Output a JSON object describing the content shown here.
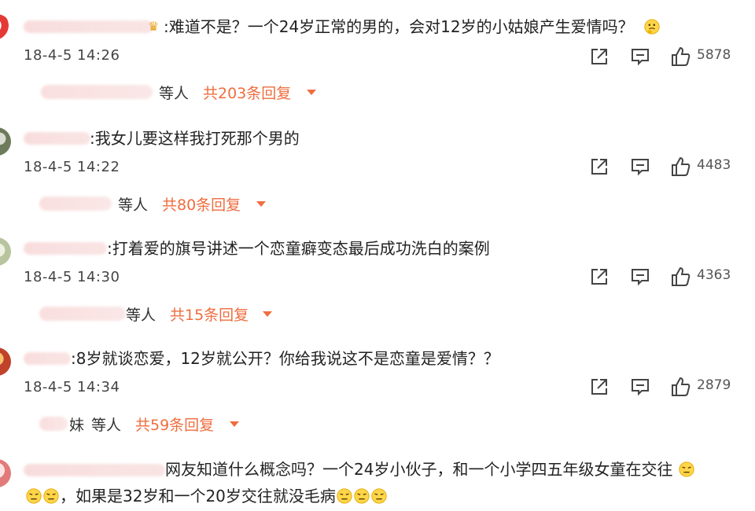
{
  "comments": [
    {
      "text": ":难道不是？一个24岁正常的男的，会对12岁的小姑娘产生爱情吗？",
      "time": "18-4-5 14:26",
      "likes": "5878",
      "others_label": "等人",
      "reply_count": "共203条回复"
    },
    {
      "text": ":我女儿要这样我打死那个男的",
      "time": "18-4-5 14:22",
      "likes": "4483",
      "others_label": "等人",
      "reply_count": "共80条回复"
    },
    {
      "text": ":打着爱的旗号讲述一个恋童癖变态最后成功洗白的案例",
      "time": "18-4-5 14:30",
      "likes": "4363",
      "others_label": "等人",
      "reply_count": "共15条回复"
    },
    {
      "text": ":8岁就谈恋爱，12岁就公开？你给我说这不是恋童是爱情？？",
      "time": "18-4-5 14:34",
      "likes": "2879",
      "name_suffix": "妹",
      "others_label": "等人",
      "reply_count": "共59条回复"
    },
    {
      "text_line1": "网友知道什么概念吗？一个24岁小伙子，和一个小学四五年级女童在交往",
      "text_line2": "，如果是32岁和一个20岁交往就没毛病"
    }
  ],
  "icons": {
    "share": "share-icon",
    "comment": "comment-icon",
    "like": "thumbs-up-icon",
    "expand": "caret-down-icon",
    "emoji": "thinking-face-emoji"
  },
  "colors": {
    "reply_link": "#ef6d3f",
    "text": "#222222",
    "meta": "#555555"
  }
}
